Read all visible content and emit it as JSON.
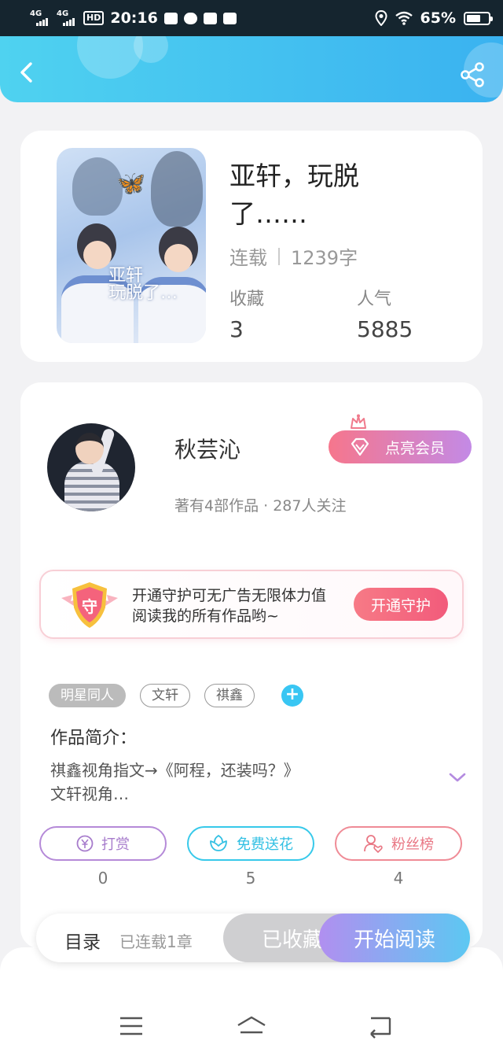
{
  "status_bar": {
    "network_1": "4G",
    "network_2": "4G",
    "hd": "HD",
    "time": "20:16",
    "battery": "65%",
    "battery_level": 0.65
  },
  "header": {
    "back_icon": "chevron-left-icon",
    "share_icon": "share-icon",
    "gradient": [
      "#4fd2f0",
      "#3ab2f0"
    ]
  },
  "book": {
    "cover_title": "亚轩\n玩脱了…",
    "title": "亚轩，玩脱了……",
    "status": "连载",
    "word_count": "1239字",
    "favorites_label": "收藏",
    "favorites_value": "3",
    "popularity_label": "人气",
    "popularity_value": "5885"
  },
  "author": {
    "name": "秋芸沁",
    "vip_button": "点亮会员",
    "meta": "著有4部作品 · 287人关注"
  },
  "guard_banner": {
    "badge_text": "守",
    "text": "开通守护可无广告无限体力值阅读我的所有作品哟~",
    "button": "开通守护"
  },
  "tags": [
    "明星同人",
    "文轩",
    "祺鑫"
  ],
  "tag_add_symbol": "+",
  "intro": {
    "label": "作品简介：",
    "text": "祺鑫视角指文→《阿程，还装吗？》\n文轩视角…"
  },
  "actions": [
    {
      "label": "打赏",
      "count": "0",
      "icon": "yen-coin-icon"
    },
    {
      "label": "免费送花",
      "count": "5",
      "icon": "flower-icon"
    },
    {
      "label": "粉丝榜",
      "count": "4",
      "icon": "fan-user-icon"
    }
  ],
  "read_bar": {
    "toc_label": "目录",
    "toc_status": "已连载1章",
    "favorited_button": "已收藏",
    "start_reading_button": "开始阅读"
  },
  "nav_bar": {
    "menu_icon": "menu-icon",
    "home_icon": "home-icon",
    "back_icon": "back-icon"
  }
}
